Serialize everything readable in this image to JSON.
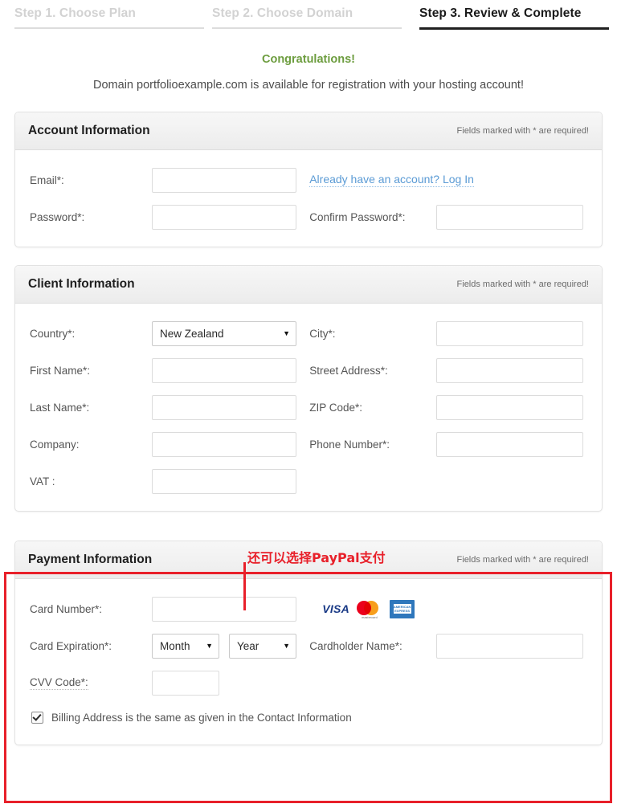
{
  "steps": [
    {
      "label": "Step 1. Choose Plan",
      "state": "inactive"
    },
    {
      "label": "Step 2. Choose Domain",
      "state": "inactive"
    },
    {
      "label": "Step 3. Review & Complete",
      "state": "active"
    }
  ],
  "intro": {
    "congratulations": "Congratulations!",
    "domain_message": "Domain portfolioexample.com is available for registration with your hosting account!"
  },
  "required_note": "Fields marked with * are required!",
  "account_information": {
    "title": "Account Information",
    "note": "Fields marked with * are required!",
    "email_label": "Email*:",
    "email_value": "",
    "login_link": "Already have an account? Log In",
    "password_label": "Password*:",
    "password_value": "",
    "confirm_password_label": "Confirm Password*:",
    "confirm_password_value": ""
  },
  "client_information": {
    "title": "Client Information",
    "note": "Fields marked with * are required!",
    "country_label": "Country*:",
    "country_value": "New Zealand",
    "city_label": "City*:",
    "city_value": "",
    "first_name_label": "First Name*:",
    "first_name_value": "",
    "street_address_label": "Street Address*:",
    "street_address_value": "",
    "last_name_label": "Last Name*:",
    "last_name_value": "",
    "zip_code_label": "ZIP Code*:",
    "zip_code_value": "",
    "company_label": "Company:",
    "company_value": "",
    "phone_number_label": "Phone Number*:",
    "phone_number_value": "",
    "vat_label": "VAT :",
    "vat_value": ""
  },
  "payment_information": {
    "title": "Payment Information",
    "note": "Fields marked with * are required!",
    "card_number_label": "Card Number*:",
    "card_number_value": "",
    "card_logos": [
      "visa-logo",
      "mastercard-logo",
      "american-express-logo"
    ],
    "visa_text": "VISA",
    "mastercard_text": "mastercard",
    "amex_line1": "AMERICAN",
    "amex_line2": "EXPRESS",
    "card_expiration_label": "Card Expiration*:",
    "month_value": "Month",
    "year_value": "Year",
    "cardholder_name_label": "Cardholder Name*:",
    "cardholder_name_value": "",
    "cvv_label": "CVV Code*:",
    "cvv_value": "",
    "billing_checkbox_label": "Billing Address is the same as given in the Contact Information",
    "billing_checkbox_checked": true
  },
  "annotation": {
    "text": "还可以选择PayPal支付",
    "color": "#e8202a"
  },
  "colors": {
    "accent_green": "#6d9d3f",
    "link_blue": "#5b9bd5",
    "annotation_red": "#e8202a",
    "panel_border": "#e2e2e2",
    "active_step": "#1a1a1a",
    "inactive_step": "#d2d2d2"
  }
}
